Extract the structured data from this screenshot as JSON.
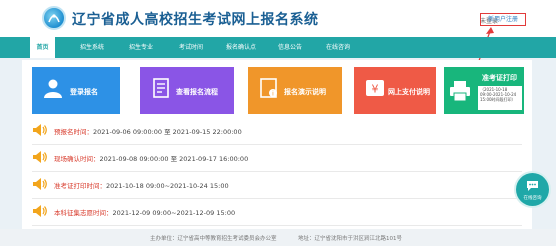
{
  "header": {
    "title": "辽宁省成人高校招生考试网上报名系统",
    "login_text": "未登录",
    "register_link": "新用户注册"
  },
  "nav": {
    "items": [
      "首页",
      "招生系统",
      "招生专业",
      "考试时间",
      "报名确认点",
      "信息公告",
      "在线咨询"
    ]
  },
  "tiles": [
    {
      "label": "登录报名",
      "color": "#2d91e6",
      "icon": "user-icon"
    },
    {
      "label": "查看报名流程",
      "color": "#8a55e6",
      "icon": "doc-icon"
    },
    {
      "label": "报名演示说明",
      "color": "#f0962a",
      "icon": "info-icon"
    },
    {
      "label": "网上支付说明",
      "color": "#ef5a46",
      "icon": "yen-icon"
    },
    {
      "label": "准考证打印",
      "color": "#18b67c",
      "icon": "printer-icon",
      "sub": "（2021-10-18 09:00-2021-10-24 15:00时间段打印）"
    }
  ],
  "notices": [
    {
      "label": "预报名时间：",
      "value": "2021-09-06 09:00:00 至 2021-09-15 22:00:00"
    },
    {
      "label": "现场确认时间：",
      "value": "2021-09-08 09:00:00 至 2021-09-17 16:00:00"
    },
    {
      "label": "准考证打印时间：",
      "value": "2021-10-18 09:00~2021-10-24 15:00"
    },
    {
      "label": "本科征集志愿时间：",
      "value": "2021-12-09 09:00~2021-12-09 15:00"
    }
  ],
  "footer": {
    "host": "主办单位：辽宁省高中等教育招生考试委员会办公室",
    "address": "地址：辽宁省沈阳市于洪区涧江北路101号"
  },
  "consult": {
    "label": "在线咨询"
  }
}
